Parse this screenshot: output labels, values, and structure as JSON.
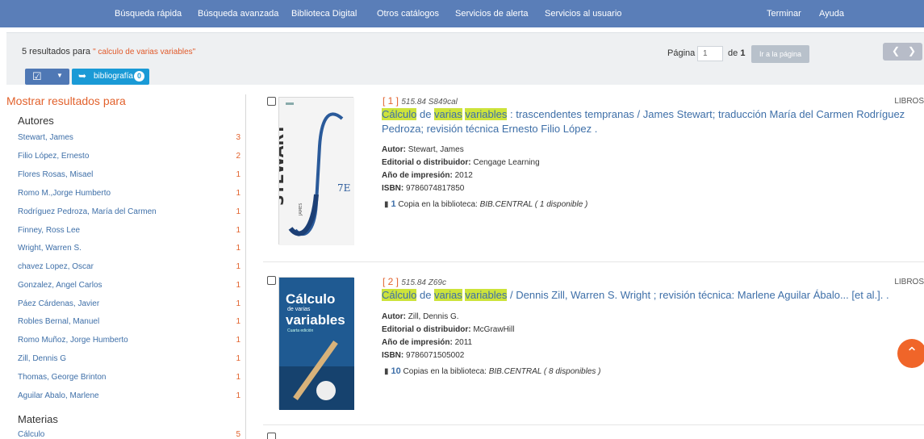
{
  "topnav": {
    "quick_search": "Búsqueda rápida",
    "advanced_search": "Búsqueda avanzada",
    "digital_library": "Biblioteca Digital",
    "other_catalogs": "Otros catálogos",
    "alert_services": "Servicios de alerta",
    "user_services": "Servicios al usuario",
    "logout": "Terminar",
    "help": "Ayuda"
  },
  "results": {
    "count_text": "5 resultados para ",
    "query": "\" calculo de varias variables\"",
    "page_label": "Página",
    "page_value": "1",
    "of_label": "de",
    "total_pages": "1",
    "goto_label": "Ir a la página",
    "prev_icon": "chevron-left",
    "next_icon": "chevron-right"
  },
  "toolbar": {
    "select_icon": "checkbox-icon",
    "bibliography_label": "bibliografía",
    "bibliography_count": "0"
  },
  "facets": {
    "title": "Mostrar resultados para",
    "authors_heading": "Autores",
    "authors": [
      {
        "name": "Stewart, James",
        "count": "3"
      },
      {
        "name": "Filio López, Ernesto",
        "count": "2"
      },
      {
        "name": "Flores Rosas, Misael",
        "count": "1"
      },
      {
        "name": "Romo M.,Jorge Humberto",
        "count": "1"
      },
      {
        "name": "Rodríguez Pedroza, María del Carmen",
        "count": "1"
      },
      {
        "name": "Finney, Ross Lee",
        "count": "1"
      },
      {
        "name": "Wright, Warren S.",
        "count": "1"
      },
      {
        "name": "chavez Lopez, Oscar",
        "count": "1"
      },
      {
        "name": "Gonzalez, Angel Carlos",
        "count": "1"
      },
      {
        "name": "Páez Cárdenas, Javier",
        "count": "1"
      },
      {
        "name": "Robles Bernal, Manuel",
        "count": "1"
      },
      {
        "name": "Romo Muñoz, Jorge Humberto",
        "count": "1"
      },
      {
        "name": "Zill, Dennis G",
        "count": "1"
      },
      {
        "name": "Thomas, George Brinton",
        "count": "1"
      },
      {
        "name": "Aguilar Abalo, Marlene",
        "count": "1"
      }
    ],
    "subjects_heading": "Materias",
    "subjects": [
      {
        "name": "Cálculo",
        "count": "5"
      }
    ]
  },
  "records": [
    {
      "num": "[ 1 ]",
      "call_number": "515.84 S849cal",
      "type": "LIBROS",
      "title_hl1": "Cálculo",
      "title_de": " de ",
      "title_hl2": "varias",
      "title_hl3": "variables",
      "title_rest": " : trascendentes tempranas / James Stewart; traducción María del Carmen Rodríguez Pedroza; revisión técnica Ernesto Filio López .",
      "author_label": "Autor:",
      "author": " Stewart, James",
      "publisher_label": "Editorial o distribuidor:",
      "publisher": " Cengage Learning",
      "year_label": "Año de impresión:",
      "year": " 2012",
      "isbn_label": "ISBN:",
      "isbn": " 9786074817850",
      "copies_count": "1",
      "copies_text": " Copia en la biblioteca: ",
      "copies_location": "BIB.CENTRAL ( 1 disponible )",
      "cover_author": "STEWART",
      "cover_subauthor": "JAMES",
      "cover_edition": "7E"
    },
    {
      "num": "[ 2 ]",
      "call_number": "515.84 Z69c",
      "type": "LIBROS",
      "title_hl1": "Cálculo",
      "title_de": " de ",
      "title_hl2": "varias",
      "title_hl3": "variables",
      "title_rest": " / Dennis Zill, Warren S. Wright ; revisión técnica: Marlene Aguilar Ábalo... [et al.]. .",
      "author_label": "Autor:",
      "author": " Zill, Dennis G.",
      "publisher_label": "Editorial o distribuidor:",
      "publisher": " McGrawHill",
      "year_label": "Año de impresión:",
      "year": " 2011",
      "isbn_label": "ISBN:",
      "isbn": " 9786071505002",
      "copies_count": "10",
      "copies_text": " Copias en la biblioteca: ",
      "copies_location": "BIB.CENTRAL ( 8 disponibles )",
      "cover_title1": "Cálculo",
      "cover_title2": "de varias",
      "cover_title3": "variables",
      "cover_sub": "Cuarta edición"
    }
  ],
  "colors": {
    "nav_bg": "#5a7eb8",
    "accent_orange": "#e2622d",
    "link_blue": "#3e6fa8",
    "highlight": "#cde33b"
  },
  "scroll_top_icon": "chevron-up-icon"
}
